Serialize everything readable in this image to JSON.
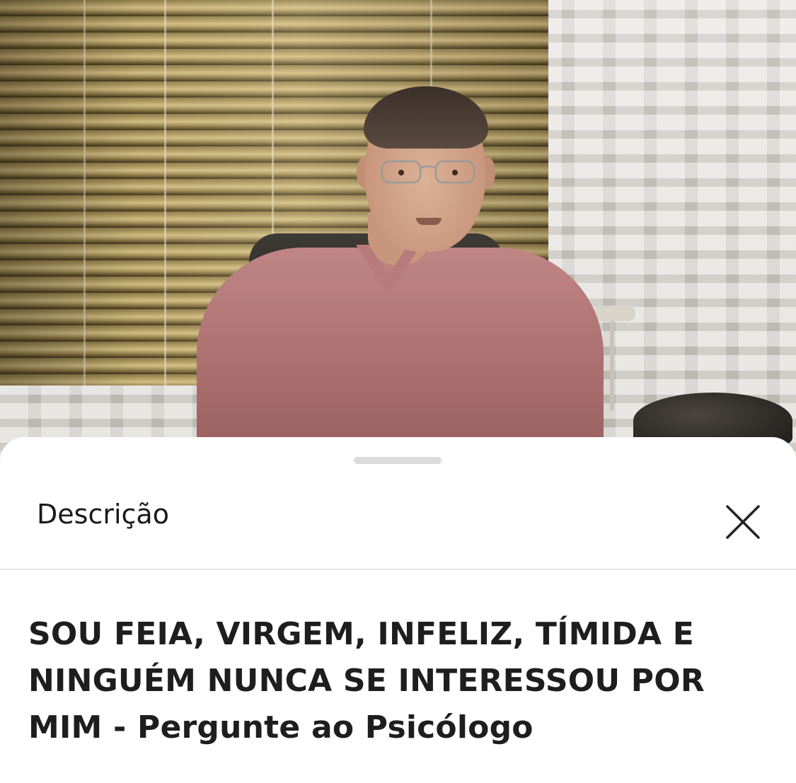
{
  "sheet": {
    "title": "Descrição",
    "close_icon": "close-icon",
    "video_title": "SOU FEIA, VIRGEM, INFELIZ, TÍMIDA E NINGUÉM NUNCA SE INTERESSOU POR MIM - Pergunte ao Psicólogo"
  },
  "colors": {
    "sheet_background": "#ffffff",
    "title_text": "#1e1e1e",
    "divider": "#e5e5e5",
    "handle": "#dcdcdc"
  }
}
